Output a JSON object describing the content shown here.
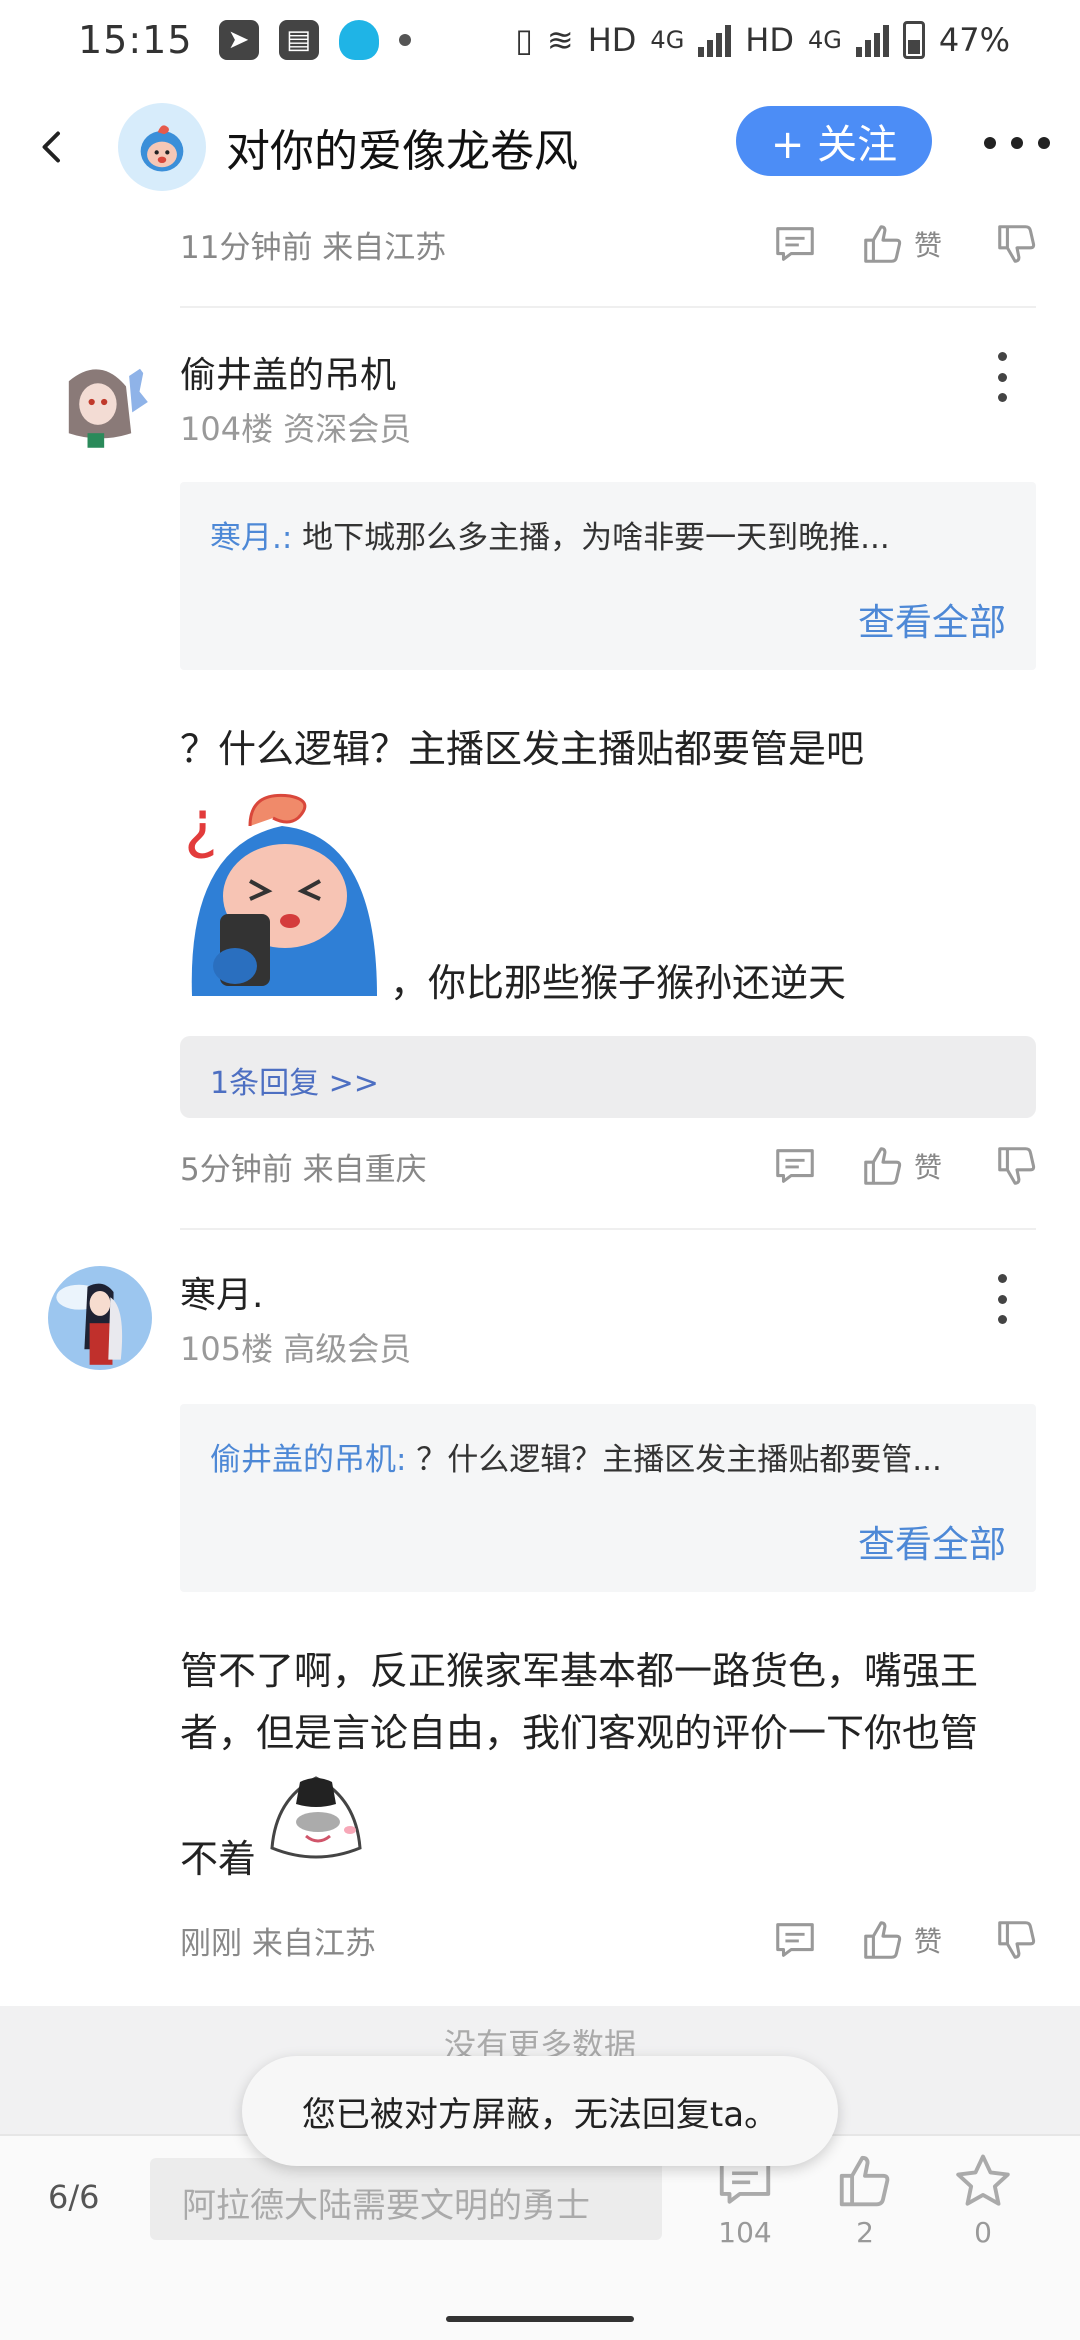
{
  "status_bar": {
    "time": "15:15",
    "network1": "HD",
    "net_small1": "4G",
    "network2": "HD",
    "net_small2": "4G",
    "battery": "47%"
  },
  "header": {
    "title": "对你的爱像龙卷风",
    "follow_label": "+ 关注"
  },
  "top_meta": {
    "text": "11分钟前 来自江苏"
  },
  "like_label": "赞",
  "posts": [
    {
      "username": "偷井盖的吊机",
      "floor": "104楼 资深会员",
      "quote_name": "寒月.:",
      "quote_text": " 地下城那么多主播，为啥非要一天到晚推...",
      "view_all": "查看全部",
      "text1": "？什么逻辑？主播区发主播贴都要管是吧",
      "text2": "，你比那些猴子猴孙还逆天",
      "reply_link": "1条回复 >>",
      "meta": "5分钟前 来自重庆"
    },
    {
      "username": "寒月.",
      "floor": "105楼 高级会员",
      "quote_name": "偷井盖的吊机:",
      "quote_text": " ？什么逻辑？主播区发主播贴都要管...",
      "view_all": "查看全部",
      "text1": "管不了啊，反正猴家军基本都一路货色，嘴强王者，但是言论自由，我们客观的评价一下你也管",
      "text2": "不着",
      "meta": "刚刚 来自江苏"
    }
  ],
  "no_more": "没有更多数据",
  "toast": "您已被对方屏蔽，无法回复ta。",
  "bottom_bar": {
    "page_indicator": "6/6",
    "reply_placeholder": "阿拉德大陆需要文明的勇士",
    "comments": "104",
    "likes": "2",
    "favorites": "0"
  }
}
